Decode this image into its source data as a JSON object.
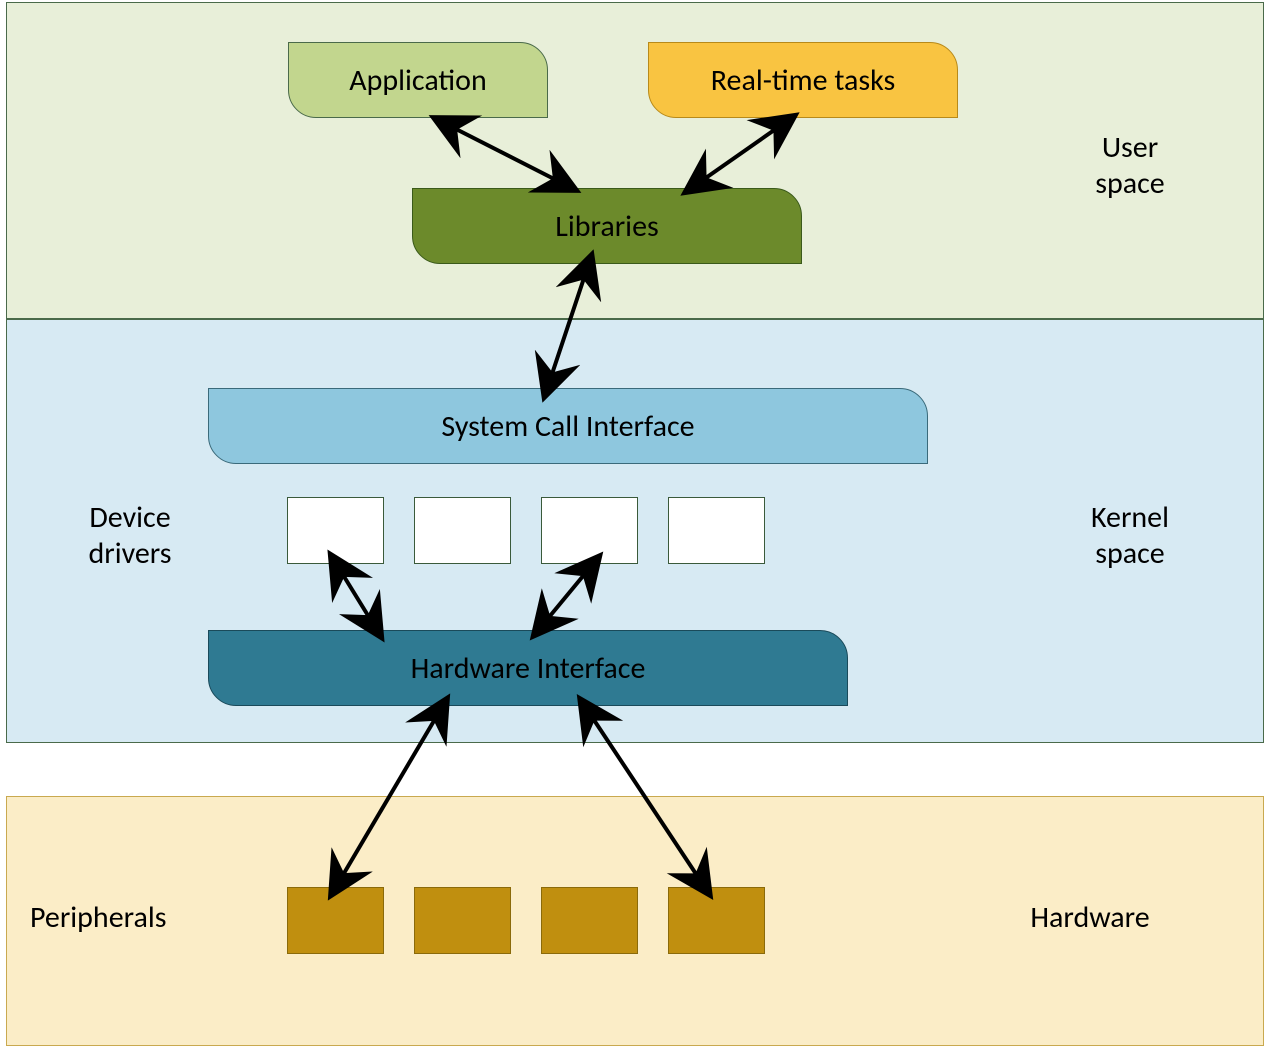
{
  "layers": {
    "user_space": {
      "label_line1": "User",
      "label_line2": "space",
      "bg": "#e8efd9",
      "border": "#4a6a4a"
    },
    "kernel_space": {
      "label_line1": "Kernel",
      "label_line2": "space",
      "bg": "#d7eaf3",
      "border": "#4a6a4a"
    },
    "hardware": {
      "label": "Hardware",
      "bg": "#fbedc7",
      "border": "#c9a94f"
    }
  },
  "nodes": {
    "application": {
      "label": "Application",
      "bg": "#c2d68e",
      "border": "#4a6a4a"
    },
    "realtime": {
      "label": "Real-time tasks",
      "bg": "#f9c441",
      "border": "#b88a1a"
    },
    "libraries": {
      "label": "Libraries",
      "bg": "#6c8a2b",
      "border": "#3a5a1a"
    },
    "syscall": {
      "label": "System Call Interface",
      "bg": "#8ec7de",
      "border": "#3a6a7a"
    },
    "hwiface": {
      "label": "Hardware Interface",
      "bg": "#2f7a92",
      "border": "#1a4a5a"
    }
  },
  "labels": {
    "device_drivers_line1": "Device",
    "device_drivers_line2": "drivers",
    "peripherals": "Peripherals"
  },
  "driver_boxes": 4,
  "peripheral_boxes": 4,
  "arrows": [
    {
      "from": "application",
      "to": "libraries"
    },
    {
      "from": "realtime",
      "to": "libraries"
    },
    {
      "from": "libraries",
      "to": "syscall"
    },
    {
      "from": "driverbox1",
      "to": "hwiface"
    },
    {
      "from": "driverbox3",
      "to": "hwiface"
    },
    {
      "from": "hwiface",
      "to": "periph1"
    },
    {
      "from": "hwiface",
      "to": "periph4"
    }
  ]
}
